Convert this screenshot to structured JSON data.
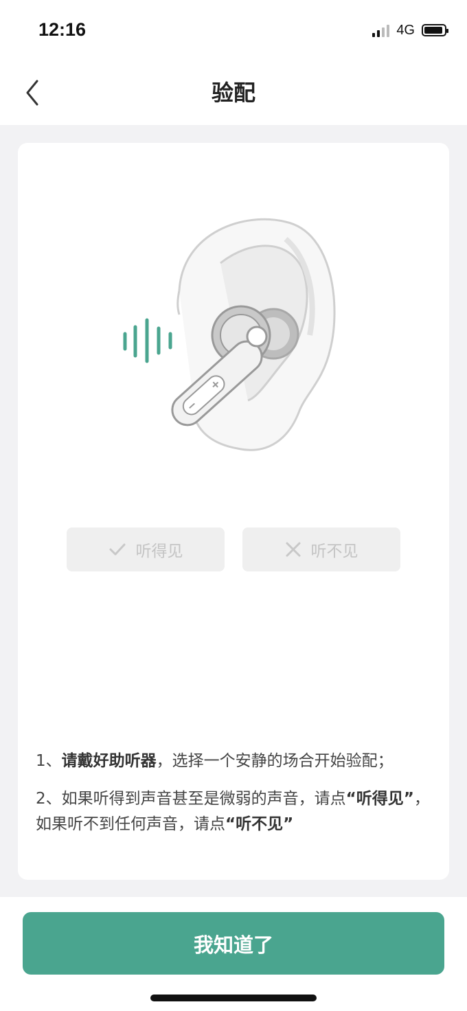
{
  "status_bar": {
    "time": "12:16",
    "network": "4G"
  },
  "nav": {
    "title": "验配",
    "back_icon": "chevron-left-icon"
  },
  "illustration": {
    "description_icon": "ear-earbud-icon",
    "accent_color": "#4aa58f"
  },
  "choices": {
    "hear_label": "听得见",
    "hear_icon": "check-icon",
    "not_hear_label": "听不见",
    "not_hear_icon": "close-icon"
  },
  "instructions": {
    "step1": {
      "prefix": "1、",
      "bold": "请戴好助听器",
      "rest": "，选择一个安静的场合开始验配；"
    },
    "step2": {
      "prefix": "2、如果听得到声音甚至是微弱的声音，请点",
      "bold1": "“听得见”",
      "middle": "，如果听不到任何声音，请点",
      "bold2": "“听不见”"
    }
  },
  "footer": {
    "confirm_label": "我知道了"
  },
  "colors": {
    "primary": "#4aa58f",
    "background": "#f2f2f4",
    "disabled_button": "#efefef",
    "disabled_text": "#c4c4c4"
  }
}
